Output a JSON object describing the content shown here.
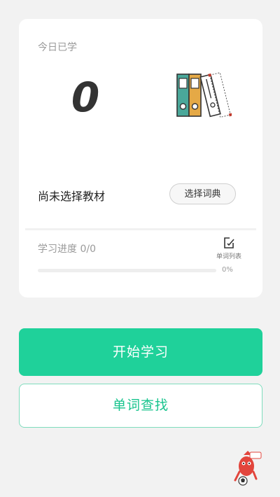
{
  "stats": {
    "today_label": "今日已学",
    "today_count": "0"
  },
  "textbook": {
    "status": "尚未选择教材",
    "select_button": "选择词典"
  },
  "progress": {
    "label": "学习进度 0/0",
    "percent_text": "0%",
    "fraction": 0,
    "word_list_label": "单词列表"
  },
  "actions": {
    "start_label": "开始学习",
    "lookup_label": "单词查找"
  },
  "colors": {
    "accent": "#1fd19a",
    "background": "#f2f2f2",
    "card": "#ffffff"
  },
  "icons": {
    "books": "books-binders-icon",
    "word_list": "edit-list-icon",
    "mascot": "mascot-icon"
  }
}
